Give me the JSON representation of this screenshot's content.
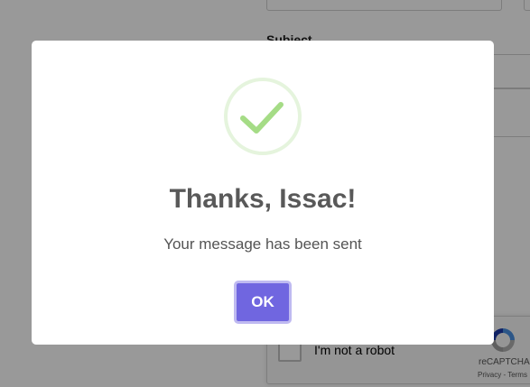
{
  "background_form": {
    "subject_label": "Subject",
    "recaptcha": {
      "checkbox_label": "I'm not a robot",
      "brand": "reCAPTCHA",
      "links": "Privacy - Terms"
    }
  },
  "dialog": {
    "title": "Thanks, Issac!",
    "message": "Your message has been sent",
    "ok_label": "OK",
    "icon": "check-icon"
  },
  "colors": {
    "overlay": "rgba(0,0,0,0.4)",
    "success_ring": "#e5f4dd",
    "success_check": "#a5dc86",
    "button": "#7066e0",
    "title": "#595959"
  }
}
